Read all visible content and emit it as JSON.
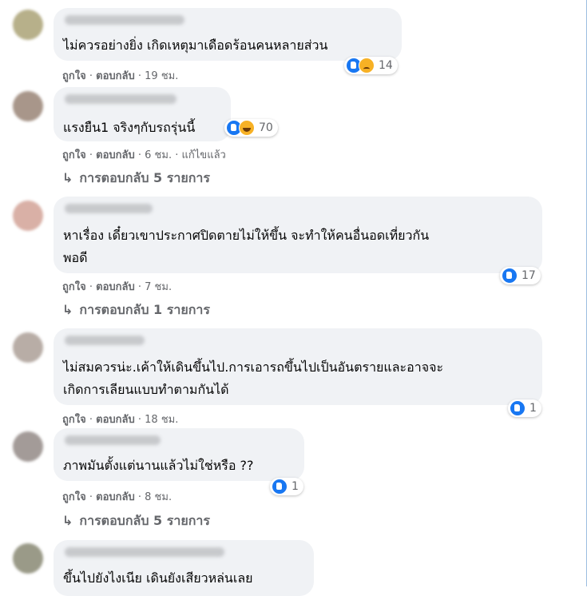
{
  "labels": {
    "like": "ถูกใจ",
    "reply": "ตอบกลับ",
    "edited": "แก้ไขแล้ว",
    "dot": "·",
    "reply_arrow": "↳"
  },
  "comments": [
    {
      "text": "ไม่ควรอย่างยิ่ง เกิดเหตุมาเดือดร้อนคนหลายส่วน",
      "reactions": [
        "like-icon",
        "sad-icon"
      ],
      "reaction_count": "14",
      "time": "19 ชม."
    },
    {
      "text": "แรงยืน1 จริงๆกับรถรุ่นนี้",
      "reactions": [
        "like-icon",
        "haha-icon"
      ],
      "reaction_count": "70",
      "time": "6 ชม.",
      "edited": true,
      "replies": "การตอบกลับ 5 รายการ"
    },
    {
      "text_lines": [
        "หาเรื่อง เดี๋ยวเขาประกาศปิดตายไม่ให้ขึ้น จะทำให้คนอื่นอดเที่ยวกัน",
        "พอดี"
      ],
      "reactions": [
        "like-icon"
      ],
      "reaction_count": "17",
      "time": "7 ชม.",
      "replies": "การตอบกลับ 1 รายการ"
    },
    {
      "text_lines": [
        "ไม่สมควรน่ะ.เค้าให้เดินขึ้นไป.การเอารถขึ้นไปเป็นอันตรายและอาจจะ",
        "เกิดการเลียนแบบทำตามกันได้"
      ],
      "reactions": [
        "like-icon"
      ],
      "reaction_count": "1",
      "time": "18 ชม."
    },
    {
      "text": "ภาพมันตั้งแต่นานแล้วไม่ใช่หรือ ??",
      "reactions": [
        "like-icon"
      ],
      "reaction_count": "1",
      "time": "8 ชม.",
      "replies": "การตอบกลับ 5 รายการ"
    },
    {
      "text": "ขึ้นไปยังไงเนีย เดินยังเสียวหล่นเลย"
    }
  ]
}
